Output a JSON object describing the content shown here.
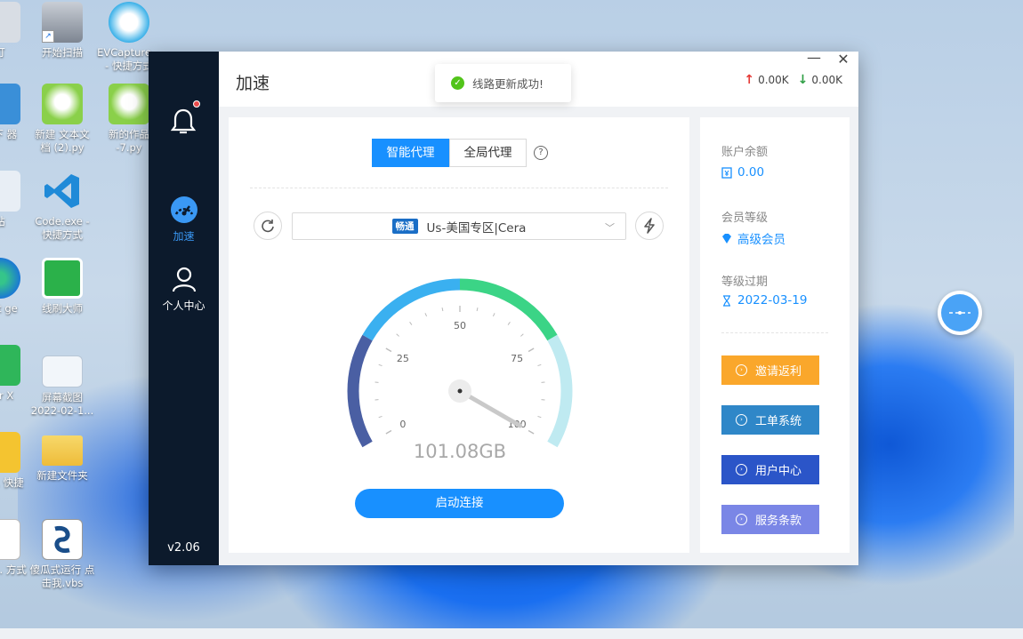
{
  "desktop": {
    "icons": [
      {
        "label": "打",
        "icon": "scanner-icon"
      },
      {
        "label": "开始扫描",
        "icon": "scanner-icon"
      },
      {
        "label": "EVCapture... - 快捷方式",
        "icon": "evcapture-icon"
      },
      {
        "label": "频下 器",
        "icon": "app-icon"
      },
      {
        "label": "新建 文本文 档 (2).py",
        "icon": "python-file-icon"
      },
      {
        "label": "新的作品 -7.py",
        "icon": "python-file-icon"
      },
      {
        "label": "站",
        "icon": "recycle-bin-icon"
      },
      {
        "label": "Code.exe - 快捷方式",
        "icon": "vscode-icon"
      },
      {
        "label": "soft ge",
        "icon": "edge-icon"
      },
      {
        "label": "线刷大师",
        "icon": "flash-tool-icon"
      },
      {
        "label": "der X",
        "icon": "hbuilder-icon"
      },
      {
        "label": "屏幕截图 2022-02-1...",
        "icon": "screenshot-file-icon"
      },
      {
        "label": "辑器. 快捷",
        "icon": "editor-icon"
      },
      {
        "label": "新建文件夹",
        "icon": "folder-icon"
      },
      {
        "label": "edit... 方式",
        "icon": "file-icon"
      },
      {
        "label": "傻瓜式运行 点击我.vbs",
        "icon": "vbs-script-icon"
      }
    ]
  },
  "sidebar": {
    "nav": [
      {
        "label": "加速",
        "icon": "speedometer-icon",
        "active": true
      },
      {
        "label": "个人中心",
        "icon": "user-icon",
        "active": false
      }
    ],
    "version": "v2.06"
  },
  "header": {
    "title": "加速",
    "upload": "0.00K",
    "download": "0.00K"
  },
  "toast": {
    "message": "线路更新成功!"
  },
  "proxy": {
    "modes": [
      "智能代理",
      "全局代理"
    ],
    "active_mode": "智能代理",
    "line_badge": "畅通",
    "line_name": "Us-美国专区|Cera"
  },
  "gauge": {
    "ticks": [
      "0",
      "25",
      "50",
      "75",
      "100"
    ],
    "value": 100,
    "reading": "101.08GB",
    "colors": [
      "#4a5fa3",
      "#3ab0f0",
      "#3bd486",
      "#bfeaf1"
    ]
  },
  "connect_label": "启动连接",
  "account": {
    "balance_label": "账户余额",
    "balance": "0.00",
    "level_label": "会员等级",
    "level": "高级会员",
    "expire_label": "等级过期",
    "expire": "2022-03-19"
  },
  "actions": [
    {
      "label": "邀请返利",
      "color": "#faa72b"
    },
    {
      "label": "工单系统",
      "color": "#2f87c8"
    },
    {
      "label": "用户中心",
      "color": "#2b55c8"
    },
    {
      "label": "服务条款",
      "color": "#7a86e6"
    }
  ]
}
